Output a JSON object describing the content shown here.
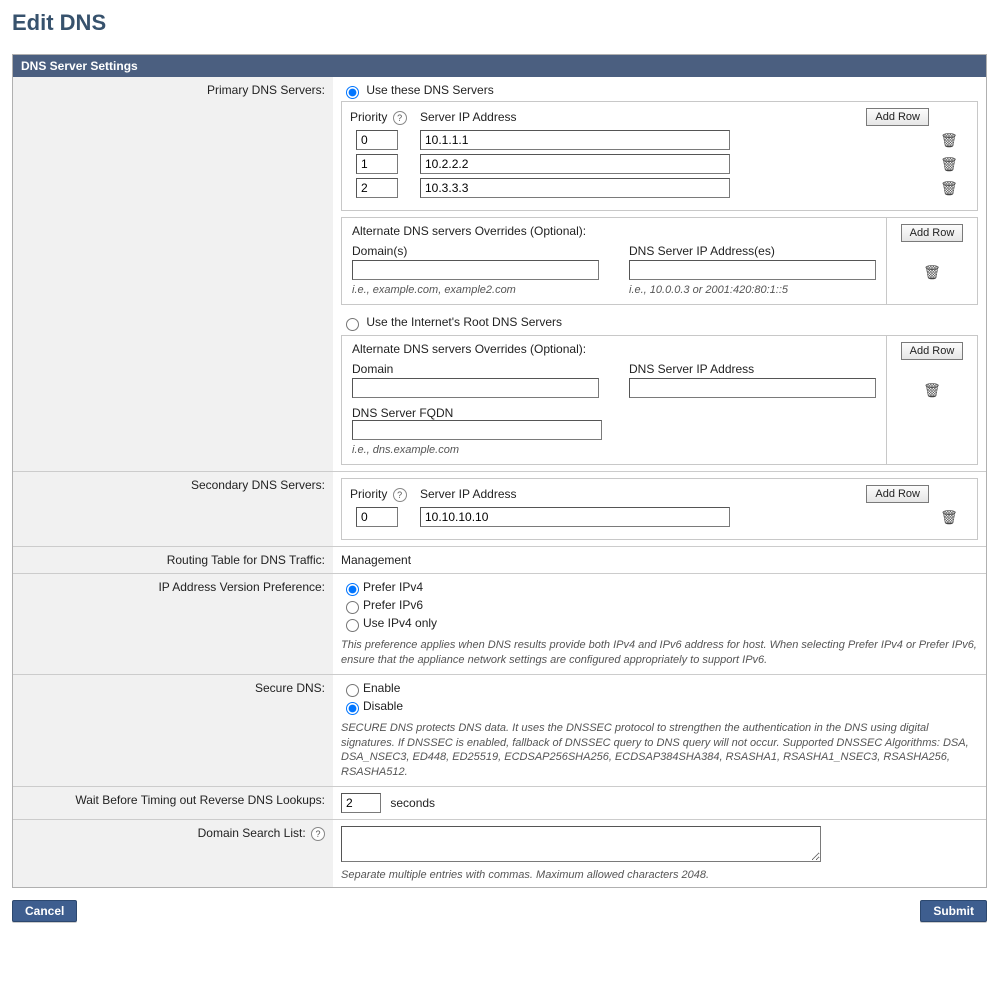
{
  "page": {
    "title": "Edit DNS",
    "panel_title": "DNS Server Settings"
  },
  "labels": {
    "primary": "Primary DNS Servers:",
    "secondary": "Secondary DNS Servers:",
    "routing": "Routing Table for DNS Traffic:",
    "ip_pref": "IP Address Version Preference:",
    "secure_dns": "Secure DNS:",
    "timeout": "Wait Before Timing out Reverse DNS Lookups:",
    "domain_search": "Domain Search List:"
  },
  "common": {
    "priority": "Priority",
    "server_ip": "Server IP Address",
    "add_row": "Add Row",
    "seconds": "seconds",
    "help": "?"
  },
  "primary": {
    "radio_use_these": "Use these DNS Servers",
    "radio_use_root": "Use the Internet's Root DNS Servers",
    "rows": [
      {
        "priority": "0",
        "server": "10.1.1.1"
      },
      {
        "priority": "1",
        "server": "10.2.2.2"
      },
      {
        "priority": "2",
        "server": "10.3.3.3"
      }
    ],
    "alt1": {
      "title": "Alternate DNS servers Overrides (Optional):",
      "domains_label": "Domain(s)",
      "ips_label": "DNS Server IP Address(es)",
      "domains_value": "",
      "ips_value": "",
      "hint_domains": "i.e., example.com, example2.com",
      "hint_ips": "i.e., 10.0.0.3 or 2001:420:80:1::5"
    },
    "alt2": {
      "title": "Alternate DNS servers Overrides (Optional):",
      "domain_label": "Domain",
      "ip_label": "DNS Server IP Address",
      "fqdn_label": "DNS Server FQDN",
      "domain_value": "",
      "ip_value": "",
      "fqdn_value": "",
      "hint_fqdn": "i.e., dns.example.com"
    }
  },
  "secondary": {
    "rows": [
      {
        "priority": "0",
        "server": "10.10.10.10"
      }
    ]
  },
  "routing": {
    "value": "Management"
  },
  "ip_pref": {
    "opt_ipv4": "Prefer IPv4",
    "opt_ipv6": "Prefer IPv6",
    "opt_ipv4_only": "Use IPv4 only",
    "desc": "This preference applies when DNS results provide both IPv4 and IPv6 address for host. When selecting Prefer IPv4 or Prefer IPv6, ensure that the appliance network settings are configured appropriately to support IPv6."
  },
  "secure_dns": {
    "enable": "Enable",
    "disable": "Disable",
    "desc": "SECURE DNS protects DNS data. It uses the DNSSEC protocol to strengthen the authentication in the DNS using digital signatures. If DNSSEC is enabled, fallback of DNSSEC query to DNS query will not occur. Supported DNSSEC Algorithms: DSA, DSA_NSEC3, ED448, ED25519, ECDSAP256SHA256, ECDSAP384SHA384, RSASHA1, RSASHA1_NSEC3, RSASHA256, RSASHA512."
  },
  "timeout": {
    "value": "2"
  },
  "domain_search": {
    "value": "",
    "hint": "Separate multiple entries with commas. Maximum allowed characters 2048."
  },
  "buttons": {
    "cancel": "Cancel",
    "submit": "Submit"
  }
}
